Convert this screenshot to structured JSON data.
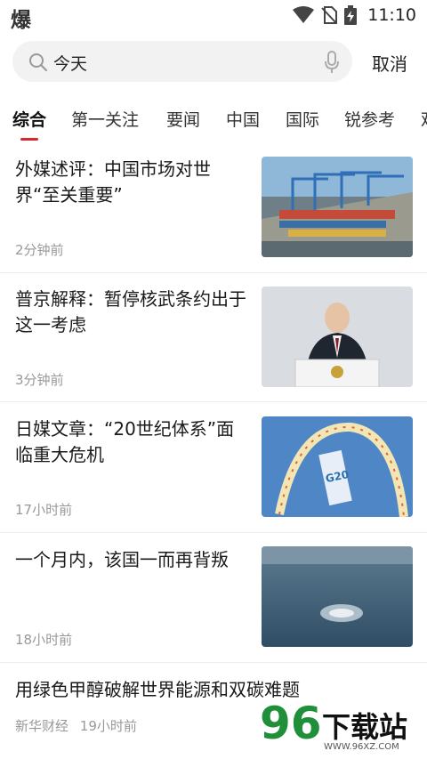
{
  "status": {
    "app_icon_text": "爆",
    "time": "11:10"
  },
  "search": {
    "query": "今天",
    "cancel_label": "取消"
  },
  "tabs": [
    {
      "label": "综合",
      "active": true
    },
    {
      "label": "第一关注"
    },
    {
      "label": "要闻"
    },
    {
      "label": "中国"
    },
    {
      "label": "国际"
    },
    {
      "label": "锐参考"
    },
    {
      "label": "观"
    }
  ],
  "news": [
    {
      "title": "外媒述评：中国市场对世界“至关重要”",
      "time": "2分钟前",
      "image": "port-cranes-image"
    },
    {
      "title": "普京解释：暂停核武条约出于这一考虑",
      "time": "3分钟前",
      "image": "putin-podium-image"
    },
    {
      "title": "日媒文章：“20世纪体系”面临重大危机",
      "time": "17小时前",
      "image": "g20-sign-image"
    },
    {
      "title": "一个月内，该国一而再背叛",
      "time": "18小时前",
      "image": "sea-bubbles-image"
    },
    {
      "title": "用绿色甲醇破解世界能源和双碳难题",
      "source": "新华财经",
      "time": "19小时前"
    }
  ],
  "watermark": {
    "number": "96",
    "text": "下载站",
    "url": "WWW.96XZ.COM"
  },
  "colors": {
    "accent": "#d7282f",
    "meta": "#999999",
    "search_bg": "#f2f2f2"
  }
}
